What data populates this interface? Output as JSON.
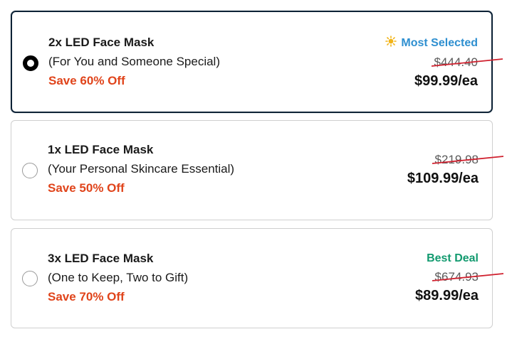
{
  "colors": {
    "selected_border": "#0d2236",
    "savings": "#e0441b",
    "badge_most_selected": "#2e8fd0",
    "badge_best_deal": "#129a6f",
    "strike_line": "#d0202e",
    "sun_icon": "#f2b418"
  },
  "options": [
    {
      "title": "2x LED Face Mask",
      "subtitle": "(For You and Someone Special)",
      "savings": "Save 60% Off",
      "badge": "Most Selected",
      "badge_icon": "sun-icon",
      "original_price": "$444.40",
      "price": "$99.99/ea",
      "selected": true
    },
    {
      "title": "1x LED Face Mask",
      "subtitle": "(Your Personal Skincare Essential)",
      "savings": "Save 50% Off",
      "badge": "",
      "original_price": "$219.98",
      "price": "$109.99/ea",
      "selected": false
    },
    {
      "title": "3x LED Face Mask",
      "subtitle": "(One to Keep, Two to Gift)",
      "savings": "Save 70% Off",
      "badge": "Best Deal",
      "original_price": "$674.93",
      "price": "$89.99/ea",
      "selected": false
    }
  ]
}
